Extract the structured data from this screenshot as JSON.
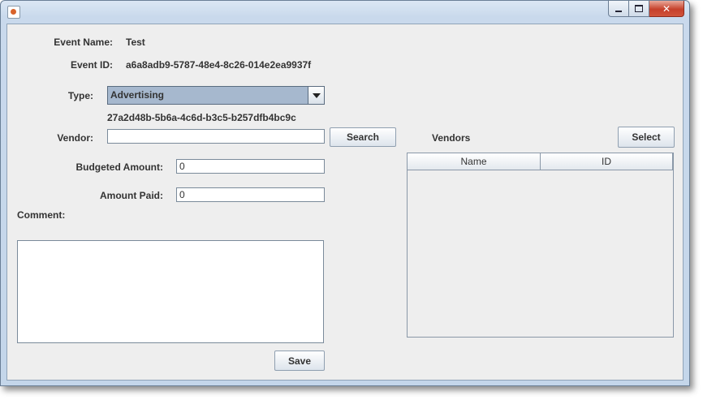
{
  "window": {
    "title": ""
  },
  "form": {
    "event_name_label": "Event Name:",
    "event_name_value": "Test",
    "event_id_label": "Event ID:",
    "event_id_value": "a6a8adb9-5787-48e4-8c26-014e2ea9937f",
    "type_label": "Type:",
    "type_selected": "Advertising",
    "type_id": "27a2d48b-5b6a-4c6d-b3c5-b257dfb4bc9c",
    "vendor_label": "Vendor:",
    "vendor_value": "",
    "search_button": "Search",
    "budgeted_label": "Budgeted Amount:",
    "budgeted_value": "0",
    "paid_label": "Amount Paid:",
    "paid_value": "0",
    "comment_label": "Comment:",
    "comment_value": "",
    "save_button": "Save"
  },
  "vendors": {
    "title": "Vendors",
    "select_button": "Select",
    "columns": [
      "Name",
      "ID"
    ],
    "rows": []
  },
  "colors": {
    "background": "#eeeeee",
    "combo_selected": "#a6b8ce",
    "close_button": "#c6402b"
  }
}
